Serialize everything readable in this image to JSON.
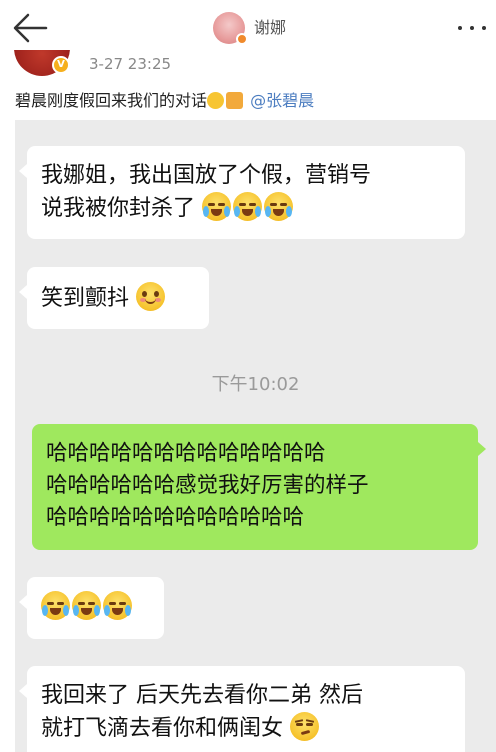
{
  "header": {
    "back_icon": "back-arrow-icon",
    "username": "谢娜",
    "more_icon": "more-dots-icon"
  },
  "post": {
    "time": "3-27 23:25",
    "text": "碧晨刚度假回来我们的对话",
    "mention": "@张碧晨"
  },
  "chat": {
    "messages": [
      {
        "side": "left",
        "lines": [
          "我娜姐，我出国放了个假，营销号",
          "说我被你封杀了"
        ],
        "emojis": [
          "crying-laughing-emoji",
          "crying-laughing-emoji",
          "crying-laughing-emoji"
        ]
      },
      {
        "side": "left",
        "lines": [
          "笑到颤抖"
        ],
        "emojis": [
          "smiling-emoji"
        ]
      },
      {
        "side": "right",
        "lines": [
          "哈哈哈哈哈哈哈哈哈哈哈哈哈",
          "哈哈哈哈哈哈感觉我好厉害的样子",
          "哈哈哈哈哈哈哈哈哈哈哈哈"
        ]
      },
      {
        "side": "left",
        "lines": [
          ""
        ],
        "emojis": [
          "crying-laughing-emoji",
          "crying-laughing-emoji",
          "crying-laughing-emoji"
        ]
      },
      {
        "side": "left",
        "lines": [
          "我回来了 后天先去看你二弟 然后",
          "就打飞滴去看你和俩闺女"
        ],
        "emojis": [
          "smirk-emoji"
        ]
      }
    ],
    "timestamp": "下午10:02"
  },
  "colors": {
    "chat_bg": "#ebebeb",
    "bubble_left": "#ffffff",
    "bubble_right": "#9fe85e",
    "mention": "#4c7dc0"
  }
}
